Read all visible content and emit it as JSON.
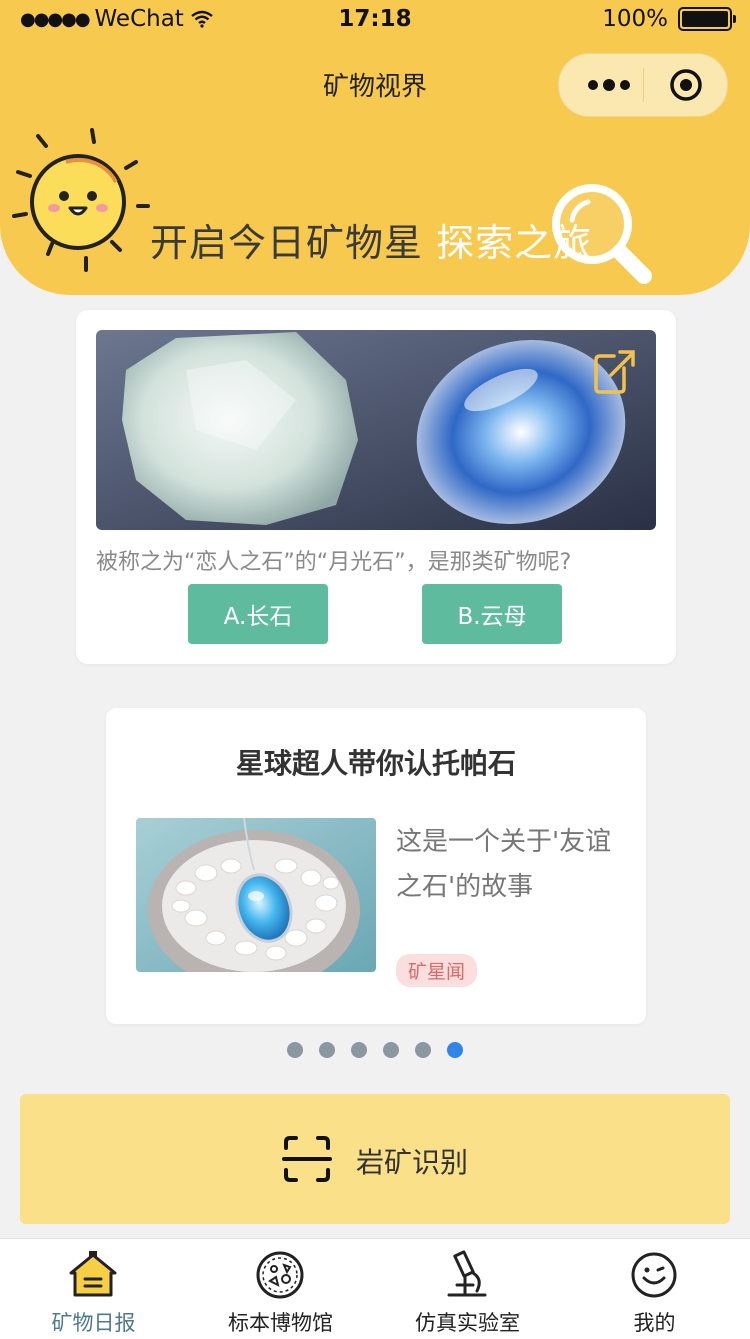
{
  "status_bar": {
    "signal": "●●●●●",
    "carrier": "WeChat",
    "time": "17:18",
    "battery": "100%"
  },
  "nav": {
    "title": "矿物视界"
  },
  "banner": {
    "text_main": "开启今日矿物星 ",
    "text_highlight": "探索之旅"
  },
  "quiz": {
    "question": "被称之为“恋人之石”的“月光石”，是那类矿物呢?",
    "options": [
      "A.长石",
      "B.云母"
    ]
  },
  "story": {
    "title": "星球超人带你认托帕石",
    "description": "这是一个关于'友谊之石'的故事",
    "tag": "矿星闻"
  },
  "carousel": {
    "total": 6,
    "active": 5
  },
  "recognize": {
    "label": "岩矿识别"
  },
  "tabbar": {
    "items": [
      {
        "label": "矿物日报",
        "icon": "house-icon",
        "active": true
      },
      {
        "label": "标本博物馆",
        "icon": "specimen-icon",
        "active": false
      },
      {
        "label": "仿真实验室",
        "icon": "microscope-icon",
        "active": false
      },
      {
        "label": "我的",
        "icon": "smiley-icon",
        "active": false
      }
    ]
  },
  "colors": {
    "header_bg": "#f7c94f",
    "option_bg": "#5fbb9e",
    "tag_bg": "#fbdede",
    "tag_text": "#d86a6a",
    "recognize_bg": "#fbe08a",
    "dot_active": "#2f86e8",
    "tab_active": "#4f7a8e"
  }
}
